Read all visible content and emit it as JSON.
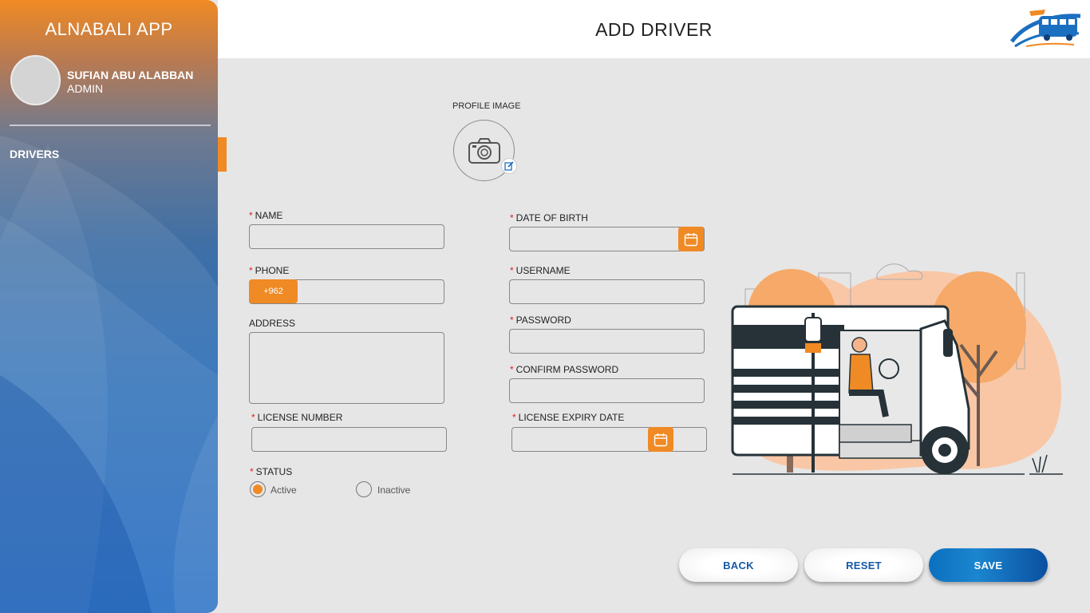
{
  "sidebar": {
    "app_title": "ALNABALI APP",
    "user_name": "SUFIAN ABU ALABBAN",
    "user_role": "ADMIN",
    "nav_items": [
      {
        "label": "DRIVERS",
        "active": true
      }
    ]
  },
  "header": {
    "title": "ADD DRIVER"
  },
  "form": {
    "profile_image_label": "PROFILE IMAGE",
    "name_label": "NAME",
    "phone_label": "PHONE",
    "phone_code": "+962",
    "address_label": "ADDRESS",
    "license_number_label": "LICENSE NUMBER",
    "status_label": "STATUS",
    "status_options": [
      "Active",
      "Inactive"
    ],
    "status_selected": "Active",
    "dob_label": "DATE OF BIRTH",
    "username_label": "USERNAME",
    "password_label": "PASSWORD",
    "confirm_password_label": "CONFIRM PASSWORD",
    "license_expiry_label": "LICENSE EXPIRY DATE",
    "required_marker": "*"
  },
  "actions": {
    "back": "BACK",
    "reset": "RESET",
    "save": "SAVE"
  },
  "colors": {
    "accent": "#f08a24",
    "primary": "#1559a6",
    "background": "#e6e6e6"
  },
  "icons": [
    "camera-icon",
    "edit-icon",
    "calendar-icon",
    "logo-bus-icon"
  ]
}
